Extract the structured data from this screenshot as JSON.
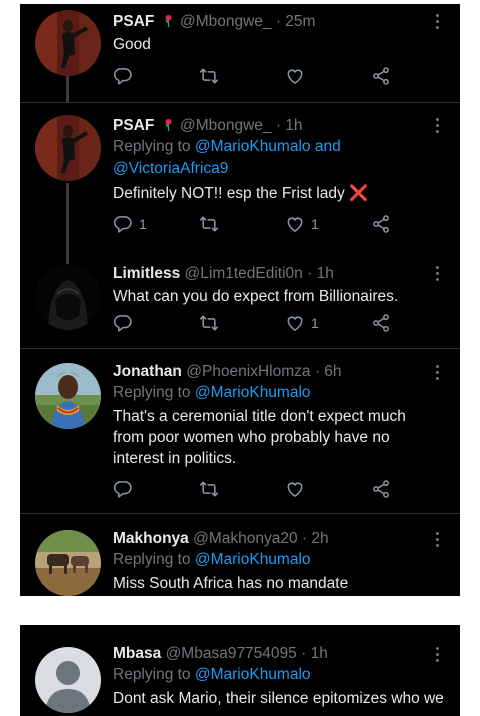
{
  "colors": {
    "background": "#000000",
    "text": "#e7e9ea",
    "muted": "#71767b",
    "link": "#1d9bf0",
    "page": "#ffffff"
  },
  "tweets": [
    {
      "name": "PSAF",
      "badge": "rose-icon",
      "handle": "@Mbongwe_",
      "time": "· 25m",
      "text": "Good",
      "reply_count": "",
      "like_count": ""
    },
    {
      "name": "PSAF",
      "badge": "rose-icon",
      "handle": "@Mbongwe_",
      "time": "· 1h",
      "reply_prefix": "Replying to",
      "reply_to_1": "@MarioKhumalo",
      "reply_and": "and",
      "reply_to_2": "@VictoriaAfrica9",
      "text": "Definitely NOT!! esp the Frist lady",
      "text_emoji": "❌",
      "reply_count": "1",
      "like_count": "1"
    },
    {
      "name": "Limitless",
      "handle": "@Lim1tedEditi0n",
      "time": "· 1h",
      "text": "What can you do expect from Billionaires.",
      "reply_count": "",
      "like_count": "1"
    },
    {
      "name": "Jonathan",
      "handle": "@PhoenixHlomza",
      "time": "· 6h",
      "reply_prefix": "Replying to",
      "reply_to_1": "@MarioKhumalo",
      "text": "That's a ceremonial title don't expect much from poor women who probably have no interest in politics.",
      "reply_count": "",
      "like_count": ""
    },
    {
      "name": "Makhonya",
      "handle": "@Makhonya20",
      "time": "· 2h",
      "reply_prefix": "Replying to",
      "reply_to_1": "@MarioKhumalo",
      "text": "Miss South Africa has no mandate"
    },
    {
      "name": "Mbasa",
      "handle": "@Mbasa97754095",
      "time": "· 1h",
      "reply_prefix": "Replying to",
      "reply_to_1": "@MarioKhumalo",
      "text": "Dont ask Mario, their silence epitomizes who we"
    }
  ]
}
